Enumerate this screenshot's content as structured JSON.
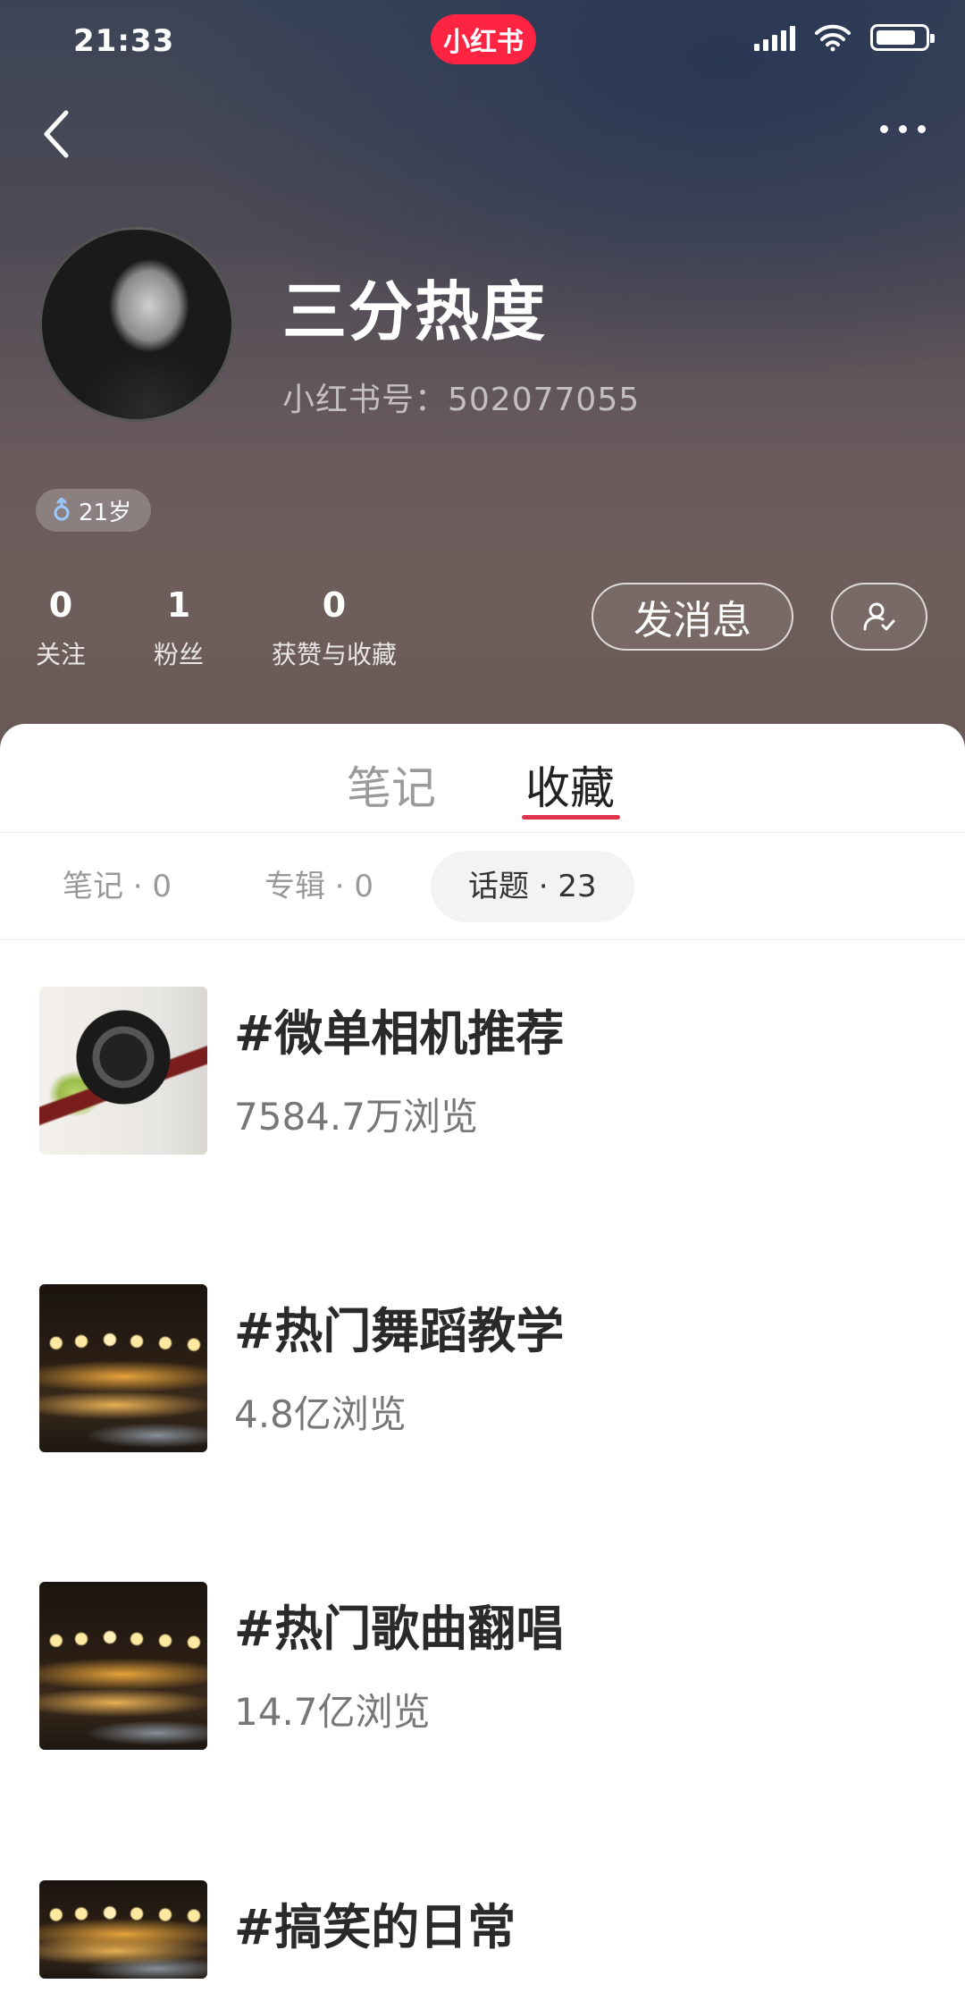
{
  "status_bar": {
    "time": "21:33",
    "app_badge": "小红书",
    "icons": [
      "signal-icon",
      "wifi-icon",
      "battery-icon"
    ]
  },
  "nav": {
    "back_icon": "back-icon",
    "more_icon": "more-icon"
  },
  "profile": {
    "nickname": "三分热度",
    "red_id": "小红书号：502077055",
    "age_tag": "21岁",
    "gender_icon": "male-icon",
    "stats": [
      {
        "value": "0",
        "label": "关注"
      },
      {
        "value": "1",
        "label": "粉丝"
      },
      {
        "value": "0",
        "label": "获赞与收藏"
      }
    ],
    "message_button": "发消息",
    "follow_icon": "user-check-icon"
  },
  "tabs": {
    "main": [
      {
        "label": "笔记",
        "active": false
      },
      {
        "label": "收藏",
        "active": true
      }
    ],
    "sub": [
      {
        "label": "笔记 · 0",
        "active": false
      },
      {
        "label": "专辑 · 0",
        "active": false
      },
      {
        "label": "话题 · 23",
        "active": true
      }
    ]
  },
  "topics": [
    {
      "title": "#微单相机推荐",
      "views": "7584.7万浏览"
    },
    {
      "title": "#热门舞蹈教学",
      "views": "4.8亿浏览"
    },
    {
      "title": "#热门歌曲翻唱",
      "views": "14.7亿浏览"
    },
    {
      "title": "#搞笑的日常",
      "views": ""
    }
  ],
  "colors": {
    "accent": "#e0344c",
    "brand": "#ff2442"
  }
}
